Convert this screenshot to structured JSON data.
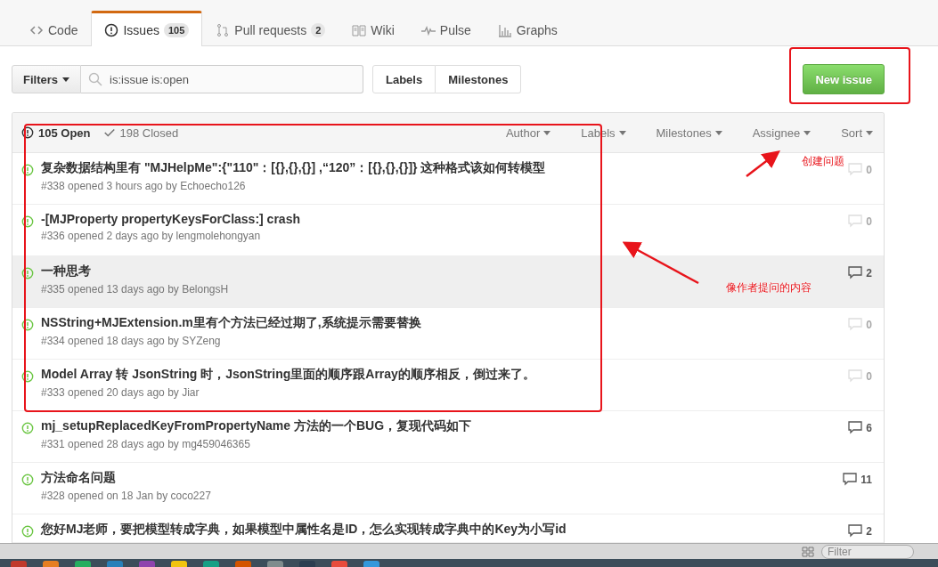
{
  "tabs": [
    {
      "label": "Code",
      "selected": false
    },
    {
      "label": "Issues",
      "count": "105",
      "selected": true
    },
    {
      "label": "Pull requests",
      "count": "2",
      "selected": false
    },
    {
      "label": "Wiki",
      "selected": false
    },
    {
      "label": "Pulse",
      "selected": false
    },
    {
      "label": "Graphs",
      "selected": false
    }
  ],
  "filters": {
    "button": "Filters",
    "query": "is:issue is:open"
  },
  "label_buttons": [
    "Labels",
    "Milestones"
  ],
  "new_issue_button": "New issue",
  "list_header": {
    "states": [
      {
        "label": "105 Open",
        "selected": true
      },
      {
        "label": "198 Closed",
        "selected": false
      }
    ],
    "menus": [
      "Author",
      "Labels",
      "Milestones",
      "Assignee",
      "Sort"
    ]
  },
  "issues": [
    {
      "title": "复杂数据结构里有 \"MJHelpMe\":{\"110\"：[{},{},{}] ,“120”：[{},{},{}]} 这种格式该如何转模型",
      "meta": "#338 opened 3 hours ago by Echoecho126",
      "comments": "0",
      "dimmed": true,
      "highlighted": false
    },
    {
      "title": "-[MJProperty propertyKeysForClass:] crash",
      "meta": "#336 opened 2 days ago by lengmolehongyan",
      "comments": "0",
      "dimmed": true,
      "highlighted": false
    },
    {
      "title": "一种思考",
      "meta": "#335 opened 13 days ago by BelongsH",
      "comments": "2",
      "dimmed": false,
      "highlighted": true
    },
    {
      "title": "NSString+MJExtension.m里有个方法已经过期了,系统提示需要替换",
      "meta": "#334 opened 18 days ago by SYZeng",
      "comments": "0",
      "dimmed": true,
      "highlighted": false
    },
    {
      "title": "Model Array 转 JsonString 时，JsonString里面的顺序跟Array的顺序相反，倒过来了。",
      "meta": "#333 opened 20 days ago by Jiar",
      "comments": "0",
      "dimmed": true,
      "highlighted": false
    },
    {
      "title": "mj_setupReplacedKeyFromPropertyName 方法的一个BUG，复现代码如下",
      "meta": "#331 opened 28 days ago by mg459046365",
      "comments": "6",
      "dimmed": false,
      "highlighted": false
    },
    {
      "title": "方法命名问题",
      "meta": "#328 opened on 18 Jan by coco227",
      "comments": "11",
      "dimmed": false,
      "highlighted": false
    },
    {
      "title": "您好MJ老师，要把模型转成字典，如果模型中属性名是ID，怎么实现转成字典中的Key为小写id",
      "comments": "2",
      "dimmed": false,
      "highlighted": false
    }
  ],
  "annotations": [
    "创建问题",
    "像作者提问的内容"
  ],
  "finder_bar": {
    "search_placeholder": "Filter"
  }
}
